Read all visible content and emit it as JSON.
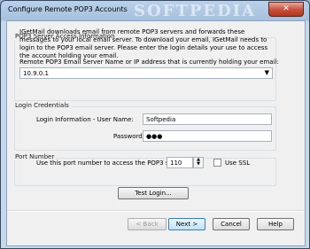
{
  "window": {
    "title": "Configure Remote POP3 Accounts",
    "watermark": "SOFTPEDIA",
    "close_glyph": "✕"
  },
  "pop3_section": {
    "label": "POP3 Server Access Information",
    "description": "IGetMail downloads email from remote POP3 servers and forwards these messages to your local email server. To download your email, IGetMail needs to login to the POP3 email server. Please enter the login details your use to access the account holding your email.",
    "server_label": "Remote POP3 Email Server Name or IP address that is currently holding your email:",
    "server_value": "10.9.0.1"
  },
  "login_section": {
    "label": "Login Credentials",
    "user_label": "Login Information - User Name:",
    "user_value": "Softpedia",
    "password_label": "Password:",
    "password_value": "●●●"
  },
  "port_section": {
    "label": "Port Number",
    "port_label": "Use this port number to access the POP3 server:",
    "port_value": "110",
    "ssl_label": "Use SSL",
    "ssl_checked": false
  },
  "buttons": {
    "test_login": "Test Login...",
    "back": "< Back",
    "next": "Next >",
    "cancel": "Cancel",
    "help": "Help"
  },
  "icons": {
    "combo_arrow": "▼",
    "spin_up": "▲",
    "spin_down": "▼"
  }
}
